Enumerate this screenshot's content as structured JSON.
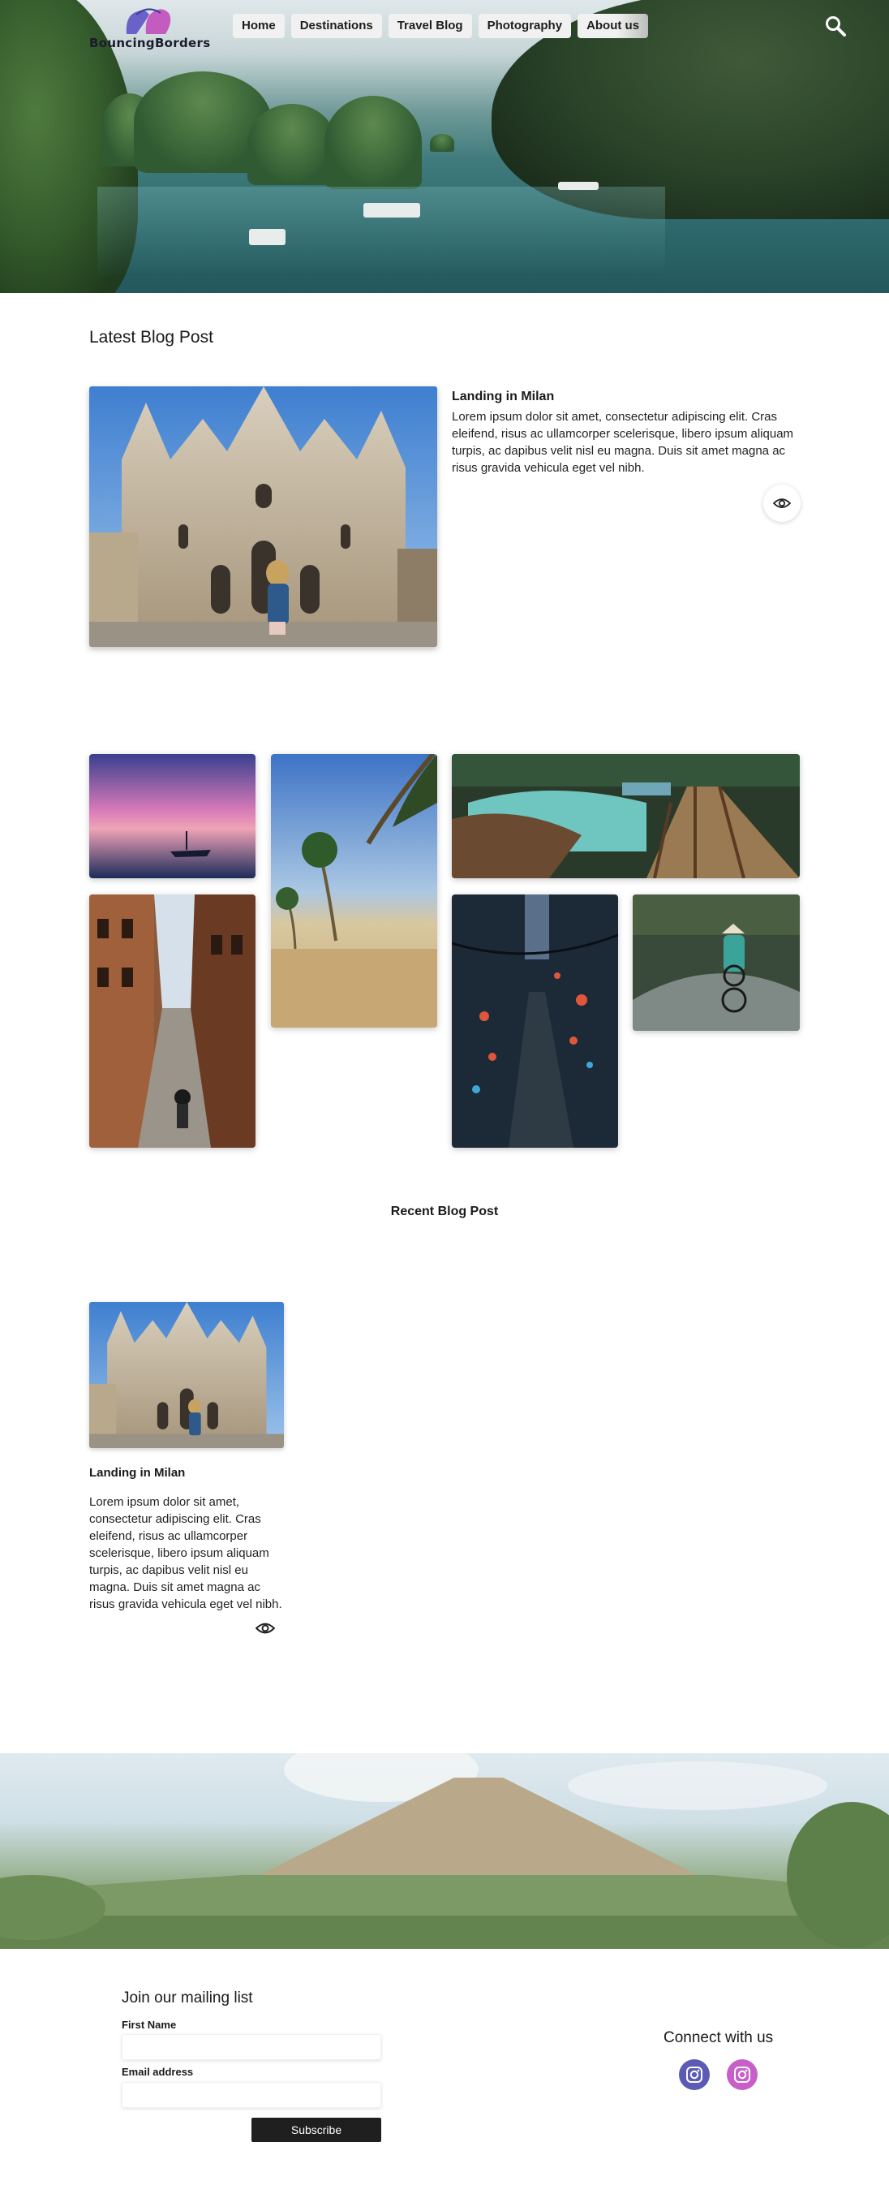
{
  "brand": {
    "name": "BouncingBorders"
  },
  "nav": {
    "items": [
      "Home",
      "Destinations",
      "Travel Blog",
      "Photography",
      "About us"
    ]
  },
  "icons": {
    "search": "search-icon",
    "view": "eye-icon",
    "social": [
      "instagram-icon",
      "instagram-icon"
    ]
  },
  "colors": {
    "nav_bg": "#f1f1f1",
    "subscribe_bg": "#1f1f1f",
    "social_1": "#5b5bb6",
    "social_2": "#c85fc8"
  },
  "latest": {
    "heading": "Latest Blog Post",
    "post": {
      "title": "Landing in Milan",
      "body": "Lorem ipsum dolor sit amet, consectetur adipiscing elit. Cras eleifend, risus ac ullamcorper scelerisque, libero ipsum aliquam turpis, ac dapibus velit nisl eu magna. Duis sit amet magna ac risus gravida vehicula eget vel nibh."
    }
  },
  "recent": {
    "heading": "Recent Blog Post",
    "post": {
      "title": "Landing in Milan",
      "body": "Lorem ipsum dolor sit amet, consectetur adipiscing elit. Cras eleifend, risus ac ullamcorper scelerisque, libero ipsum aliquam turpis, ac dapibus velit nisl eu magna. Duis sit amet magna ac risus gravida vehicula eget vel nibh."
    }
  },
  "footer": {
    "mailing_title": "Join our mailing list",
    "first_name_label": "First Name",
    "first_name_value": "",
    "email_label": "Email address",
    "email_value": "",
    "subscribe_label": "Subscribe",
    "connect_title": "Connect with us"
  }
}
